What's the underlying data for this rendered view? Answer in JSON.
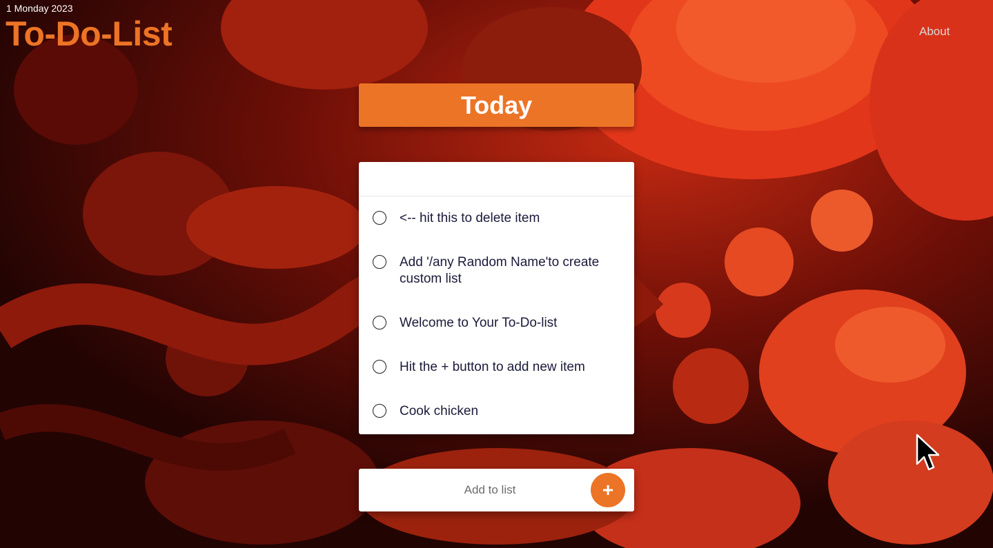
{
  "header": {
    "date": "1 Monday 2023",
    "brand": "To-Do-List",
    "about_label": "About"
  },
  "list": {
    "title": "Today",
    "items": [
      {
        "text": "<-- hit this to delete item"
      },
      {
        "text": "Add '/any Random Name'to create custom list"
      },
      {
        "text": "Welcome to Your To-Do-list"
      },
      {
        "text": "Hit the + button to add new item"
      },
      {
        "text": "Cook chicken"
      }
    ]
  },
  "add": {
    "placeholder": "Add to list",
    "button_label": "+"
  },
  "colors": {
    "accent": "#ec7426",
    "background": "#2a0604"
  }
}
